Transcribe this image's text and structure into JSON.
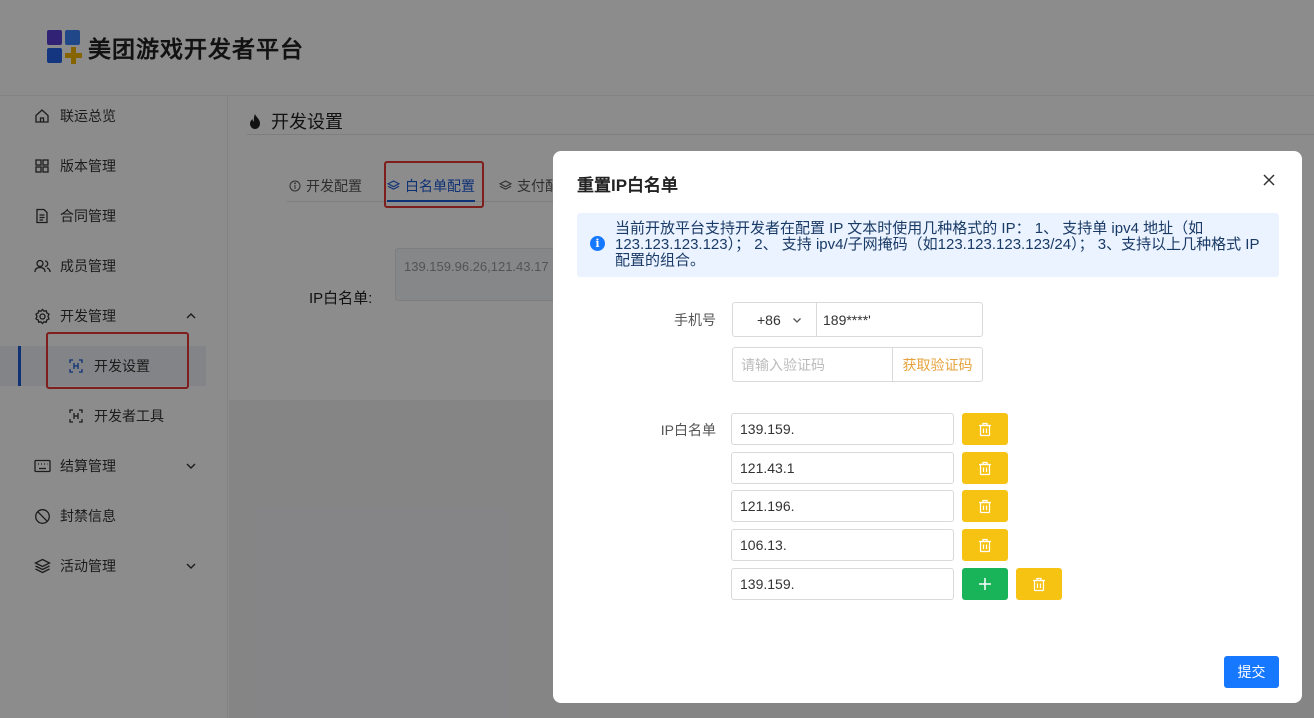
{
  "app": {
    "brand": "美团游戏开发者平台"
  },
  "sidebar": {
    "items": [
      {
        "label": "联运总览",
        "icon": "home-icon"
      },
      {
        "label": "版本管理",
        "icon": "grid-icon"
      },
      {
        "label": "合同管理",
        "icon": "document-icon"
      },
      {
        "label": "成员管理",
        "icon": "users-icon"
      },
      {
        "label": "开发管理",
        "icon": "gear-icon",
        "expanded": true
      },
      {
        "label": "开发设置",
        "icon": "dev-settings-icon",
        "active": true
      },
      {
        "label": "开发者工具",
        "icon": "dev-tools-icon"
      },
      {
        "label": "结算管理",
        "icon": "keyboard-icon"
      },
      {
        "label": "封禁信息",
        "icon": "ban-icon"
      },
      {
        "label": "活动管理",
        "icon": "layers-icon"
      }
    ]
  },
  "main": {
    "title": "开发设置",
    "tabs": [
      {
        "label": "开发配置"
      },
      {
        "label": "白名单配置",
        "active": true
      },
      {
        "label": "支付配"
      }
    ],
    "ip_label": "IP白名单:",
    "ip_value": "139.159.96.26,121.43.17"
  },
  "modal": {
    "title": "重置IP白名单",
    "info": "当前开放平台支持开发者在配置 IP 文本时使用几种格式的 IP： 1、 支持单 ipv4 地址（如123.123.123.123）； 2、 支持 ipv4/子网掩码（如123.123.123.123/24）； 3、支持以上几种格式 IP 配置的组合。",
    "phone_label": "手机号",
    "country_code": "+86",
    "phone_value": "189****'",
    "code_placeholder": "请输入验证码",
    "get_code": "获取验证码",
    "ip_label": "IP白名单",
    "ips": [
      "139.159.",
      "121.43.1",
      "121.196.",
      "106.13.",
      "139.159."
    ],
    "submit": "提交"
  },
  "colors": {
    "accent": "#1a5ad7",
    "primary_button": "#1677ff",
    "delete_button": "#f7c313",
    "add_button": "#19b35a",
    "highlight": "#e53935"
  }
}
